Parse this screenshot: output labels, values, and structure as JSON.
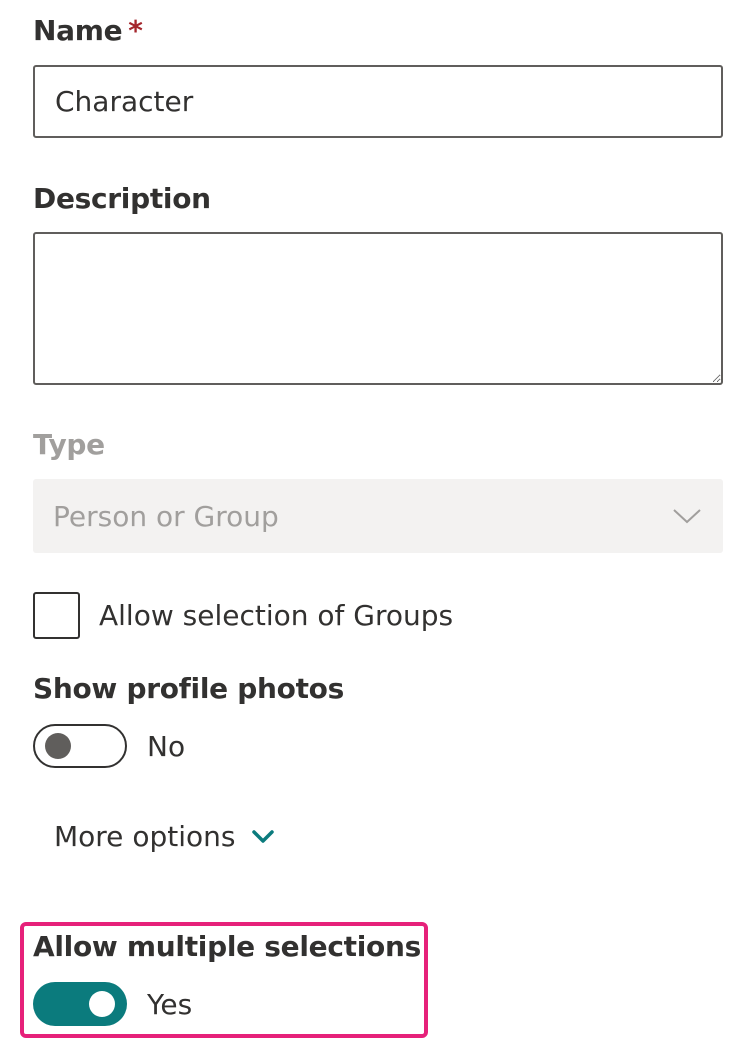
{
  "form": {
    "name": {
      "label": "Name",
      "required_marker": "*",
      "value": "Character"
    },
    "description": {
      "label": "Description",
      "value": ""
    },
    "type": {
      "label": "Type",
      "selected": "Person or Group",
      "icon": "chevron-down-icon"
    },
    "allow_groups": {
      "label": "Allow selection of Groups",
      "checked": false
    },
    "show_profile_photos": {
      "label": "Show profile photos",
      "state_text": "No",
      "on": false
    },
    "more_options": {
      "label": "More options",
      "icon": "chevron-down-icon"
    },
    "allow_multiple": {
      "label": "Allow multiple selections",
      "state_text": "Yes",
      "on": true
    }
  },
  "colors": {
    "accent": "#0b7b7d",
    "required": "#a4262c",
    "highlight": "#e6217a",
    "disabled_text": "#a19f9d",
    "disabled_bg": "#f3f2f1"
  }
}
